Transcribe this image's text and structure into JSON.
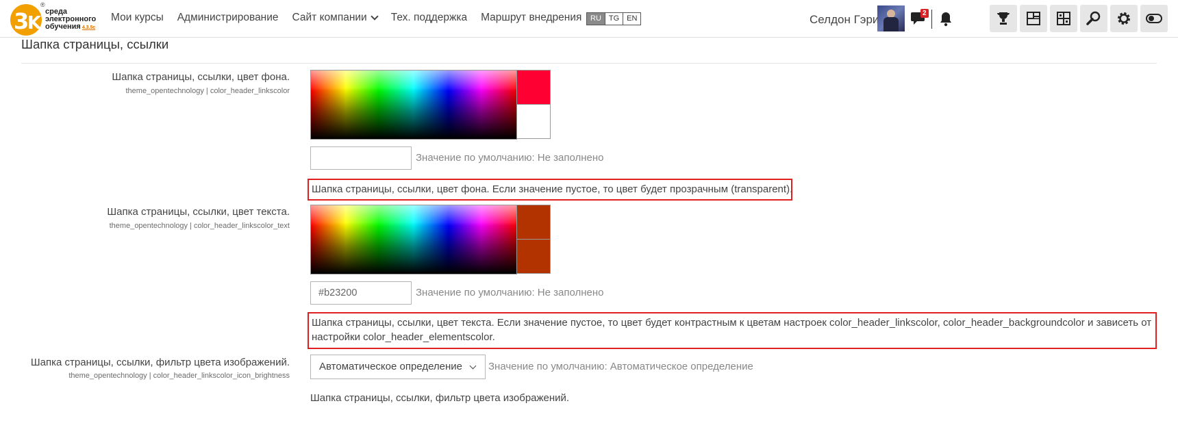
{
  "header": {
    "logo": {
      "brand_line1": "среда",
      "brand_line2": "электронного",
      "brand_line3": "обучения",
      "version": "4.3.5c",
      "reg_mark": "®"
    },
    "nav": [
      {
        "label": "Мои курсы"
      },
      {
        "label": "Администрирование"
      },
      {
        "label": "Сайт компании",
        "has_dropdown": true
      },
      {
        "label": "Тех. поддержка"
      },
      {
        "label": "Маршрут внедрения"
      }
    ],
    "languages": [
      {
        "code": "RU",
        "active": true
      },
      {
        "code": "TG",
        "active": false
      },
      {
        "code": "EN",
        "active": false
      }
    ],
    "user_name": "Селдон Гэри",
    "messages_badge": "2",
    "tools": [
      "trophy-icon",
      "dashboard-icon",
      "layout-icon",
      "search-icon",
      "gear-icon",
      "toggle-icon"
    ]
  },
  "section": {
    "title": "Шапка страницы, ссылки"
  },
  "settings": [
    {
      "title": "Шапка страницы, ссылки, цвет фона.",
      "key": "theme_opentechnology | color_header_linkscolor",
      "swatch_top": "#ff0033",
      "swatch_bottom": "#ffffff",
      "value": "",
      "default": "Значение по умолчанию: Не заполнено",
      "description": "Шапка страницы, ссылки, цвет фона. Если значение пустое, то цвет будет прозрачным (transparent)."
    },
    {
      "title": "Шапка страницы, ссылки, цвет текста.",
      "key": "theme_opentechnology | color_header_linkscolor_text",
      "swatch_top": "#b23200",
      "swatch_bottom": "#b23200",
      "value": "#b23200",
      "default": "Значение по умолчанию: Не заполнено",
      "description": "Шапка страницы, ссылки, цвет текста. Если значение пустое, то цвет будет контрастным к цветам настроек color_header_linkscolor, color_header_backgroundcolor и зависеть от настройки color_header_elementscolor."
    },
    {
      "title": "Шапка страницы, ссылки, фильтр цвета изображений.",
      "key": "theme_opentechnology | color_header_linkscolor_icon_brightness",
      "select_value": "Автоматическое определение",
      "default": "Значение по умолчанию: Автоматическое определение",
      "description": "Шапка страницы, ссылки, фильтр цвета изображений."
    }
  ],
  "colors": {
    "accent_red": "#e02020",
    "badge": "#d8232a",
    "logo_orange": "#f2a000"
  }
}
